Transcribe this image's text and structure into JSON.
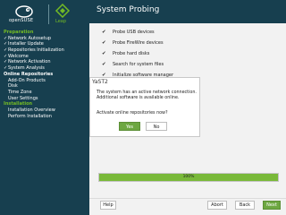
{
  "branding": {
    "opensuse_word": "openSUSE",
    "leap_word": "Leap",
    "accent": "#73ba25",
    "sidebar_bg": "#173f4f"
  },
  "sidebar": {
    "steps": [
      {
        "label": "Preparation",
        "kind": "section"
      },
      {
        "label": "Network Autosetup",
        "kind": "done"
      },
      {
        "label": "Installer Update",
        "kind": "done"
      },
      {
        "label": "Repositories Initialization",
        "kind": "done"
      },
      {
        "label": "Welcome",
        "kind": "done"
      },
      {
        "label": "Network Activation",
        "kind": "done"
      },
      {
        "label": "System Analysis",
        "kind": "done"
      },
      {
        "label": "Online Repositories",
        "kind": "current"
      },
      {
        "label": "Add-On Products",
        "kind": "todo"
      },
      {
        "label": "Disk",
        "kind": "todo"
      },
      {
        "label": "Time Zone",
        "kind": "todo"
      },
      {
        "label": "User Settings",
        "kind": "todo"
      },
      {
        "label": "Installation",
        "kind": "section"
      },
      {
        "label": "Installation Overview",
        "kind": "todo"
      },
      {
        "label": "Perform Installation",
        "kind": "todo"
      }
    ]
  },
  "header": {
    "title": "System Probing"
  },
  "tasks": [
    {
      "label": "Probe USB devices"
    },
    {
      "label": "Probe FireWire devices"
    },
    {
      "label": "Probe hard disks"
    },
    {
      "label": "Search for system files"
    },
    {
      "label": "Initialize software manager"
    }
  ],
  "dialog": {
    "title": "YaST2",
    "line1": "The system has an active network connection.",
    "line2": "Additional software is available online.",
    "question": "Activate online repositories now?",
    "yes_label": "Yes",
    "no_label": "No"
  },
  "progress": {
    "value": 1.0,
    "label": "100%",
    "color": "#79b939"
  },
  "footer": {
    "help_label": "Help",
    "abort_label": "Abort",
    "back_label": "Back",
    "next_label": "Next"
  }
}
